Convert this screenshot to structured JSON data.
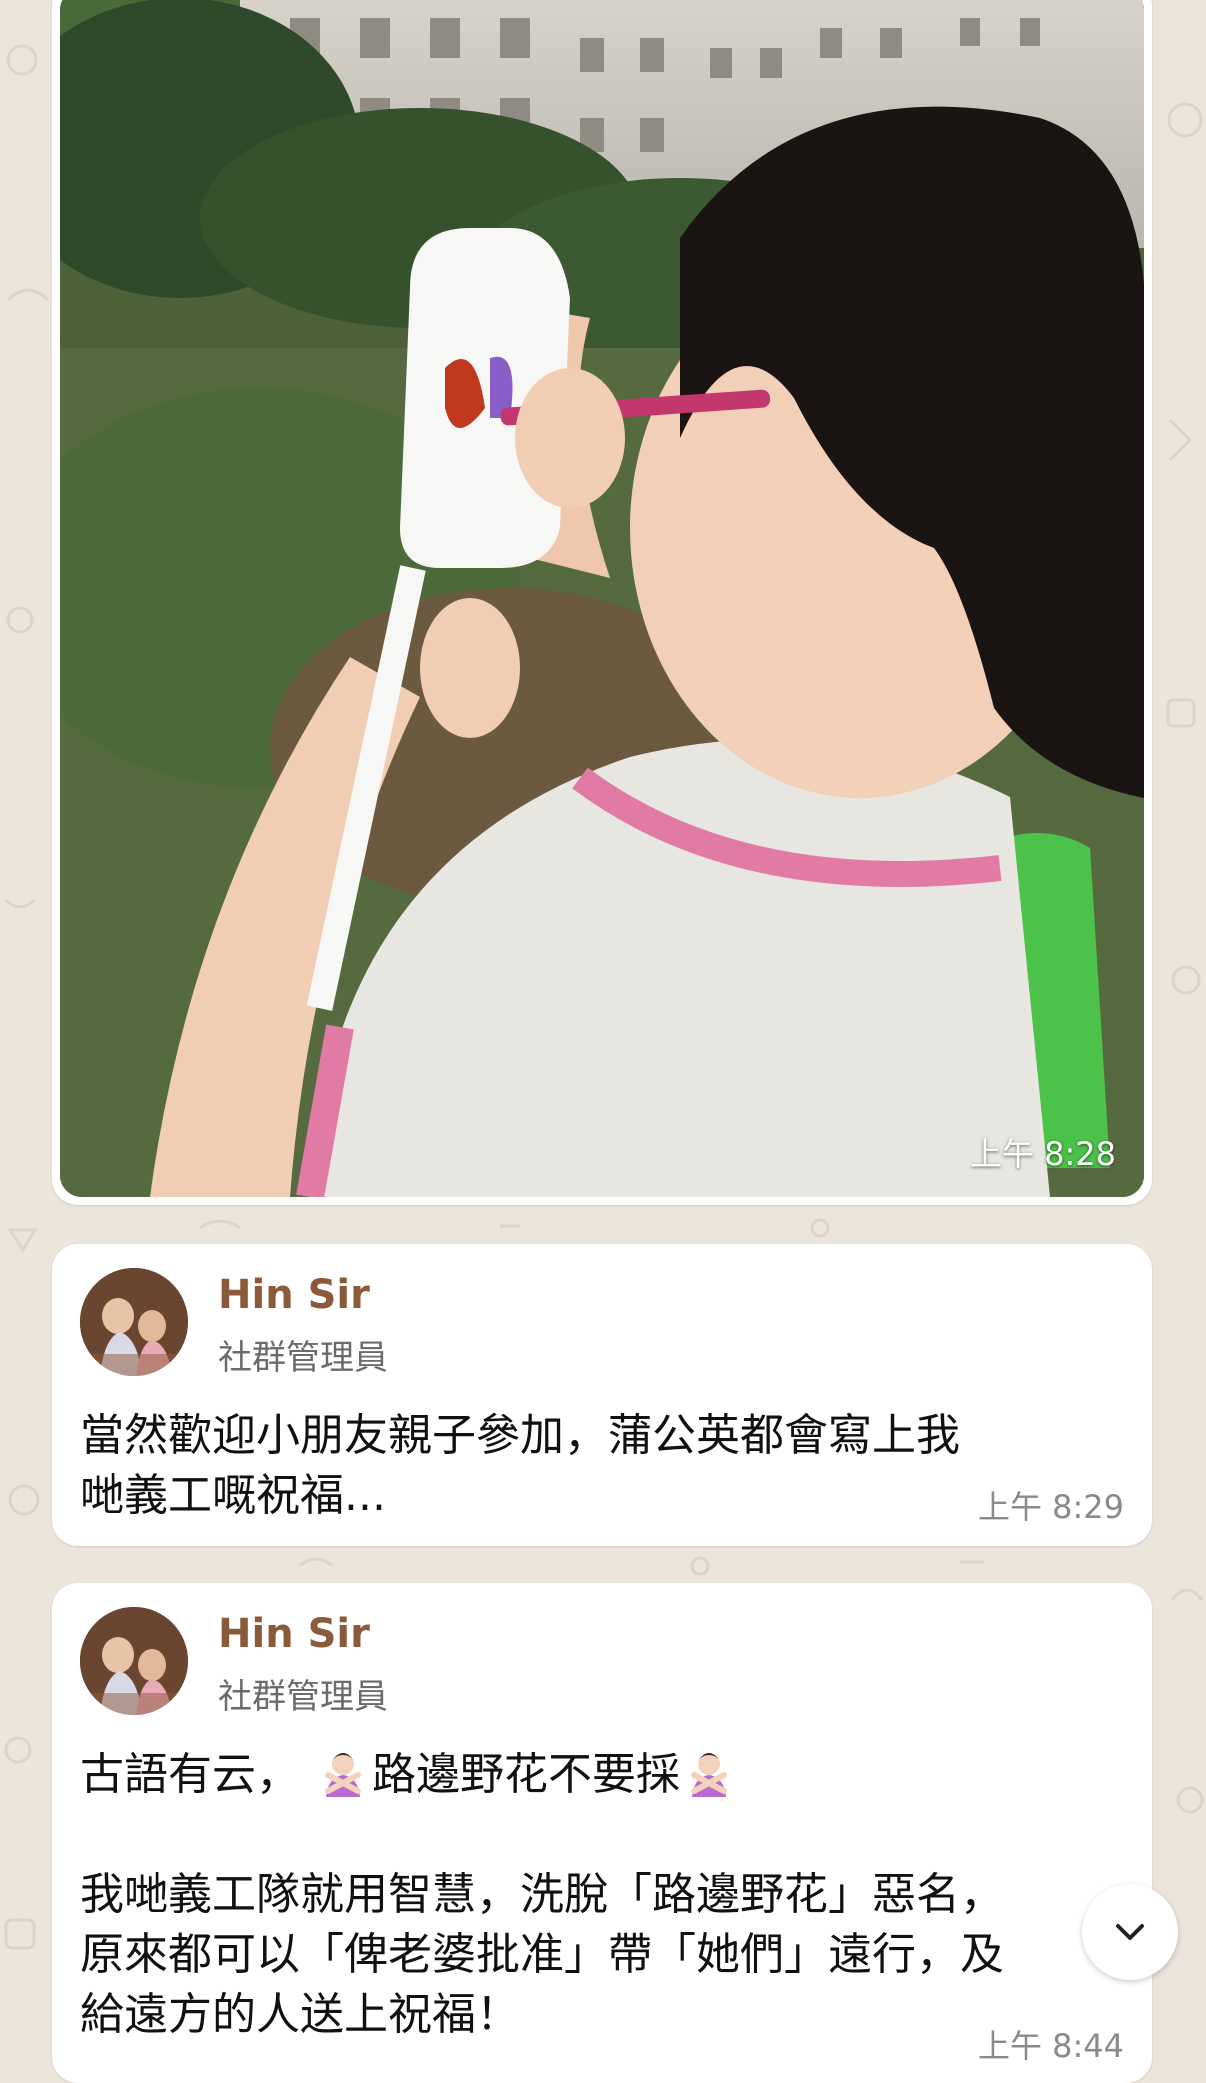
{
  "image_message": {
    "time": "上午 8:28"
  },
  "messages": [
    {
      "sender": "Hin Sir",
      "role": "社群管理員",
      "text": "當然歡迎小朋友親子參加，蒲公英都會寫上我\n哋義工嘅祝福...",
      "time": "上午 8:29"
    },
    {
      "sender": "Hin Sir",
      "role": "社群管理員",
      "line1_prefix": "古語有云，",
      "line1_emoji": "person-gesturing-no-icon",
      "line1_text": "路邊野花不要採",
      "body": "我哋義工隊就用智慧，洗脫「路邊野花」惡名，\n原來都可以「俾老婆批准」帶「她們」遠行，及\n給遠方的人送上祝福！",
      "time": "上午 8:44"
    }
  ],
  "colors": {
    "sender": "#8a5a3a",
    "role": "#6b6b6b",
    "background": "#ece5dc"
  }
}
